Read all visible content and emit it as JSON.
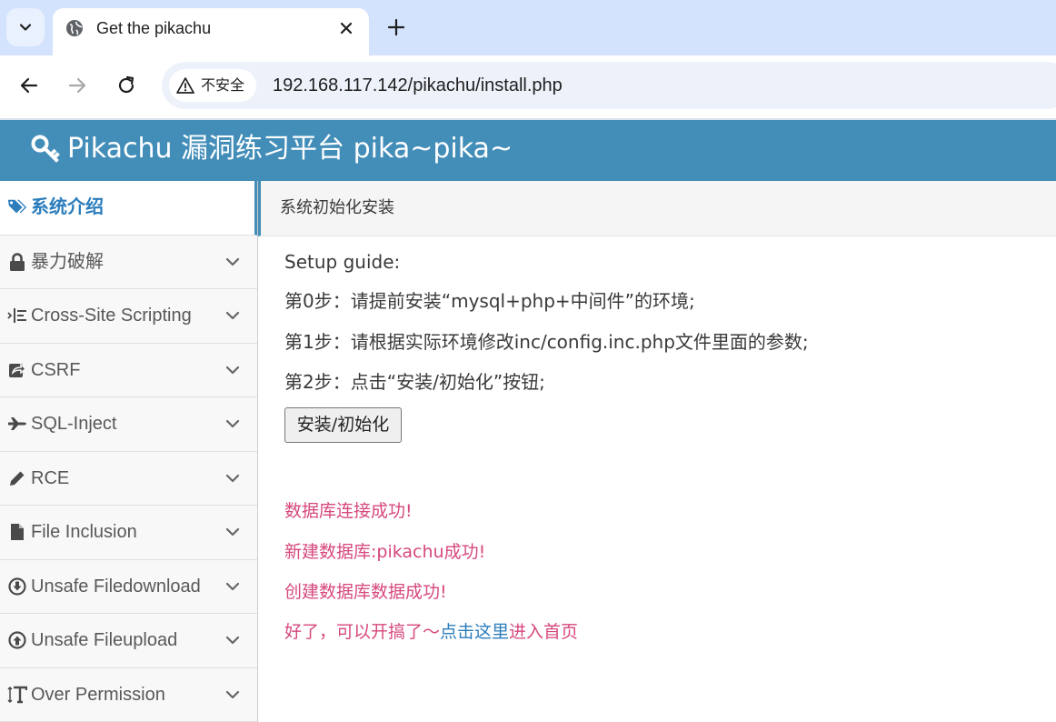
{
  "browser": {
    "tab_title": "Get the pikachu",
    "security_label": "不安全",
    "url": "192.168.117.142/pikachu/install.php"
  },
  "header": {
    "title": "Pikachu 漏洞练习平台 pika~pika~",
    "color": "#438eb9"
  },
  "sidebar": {
    "items": [
      {
        "label": "系统介绍",
        "icon": "tags-icon"
      },
      {
        "label": "暴力破解",
        "icon": "lock-icon"
      },
      {
        "label": "Cross-Site Scripting",
        "icon": "list-indent-icon"
      },
      {
        "label": "CSRF",
        "icon": "share-box-icon"
      },
      {
        "label": "SQL-Inject",
        "icon": "plane-icon"
      },
      {
        "label": "RCE",
        "icon": "pencil-icon"
      },
      {
        "label": "File Inclusion",
        "icon": "file-icon"
      },
      {
        "label": "Unsafe Filedownload",
        "icon": "download-circle-icon"
      },
      {
        "label": "Unsafe Fileupload",
        "icon": "upload-circle-icon"
      },
      {
        "label": "Over Permission",
        "icon": "text-height-icon"
      }
    ]
  },
  "breadcrumb": "系统初始化安装",
  "guide": {
    "heading": "Setup guide:",
    "step0": "第0步：请提前安装“mysql+php+中间件”的环境;",
    "step1": "第1步：请根据实际环境修改inc/config.inc.php文件里面的参数;",
    "step2": "第2步：点击“安装/初始化”按钮;",
    "button": "安装/初始化"
  },
  "messages": {
    "db_connect": "数据库连接成功!",
    "db_create": "新建数据库:pikachu成功!",
    "data_create": "创建数据库数据成功!",
    "done_prefix": "好了，可以开搞了～",
    "done_link": "点击这里",
    "done_suffix": "进入首页"
  },
  "colors": {
    "accent": "#438eb9",
    "success_message": "#d6487e",
    "link": "#2b7dbc"
  }
}
